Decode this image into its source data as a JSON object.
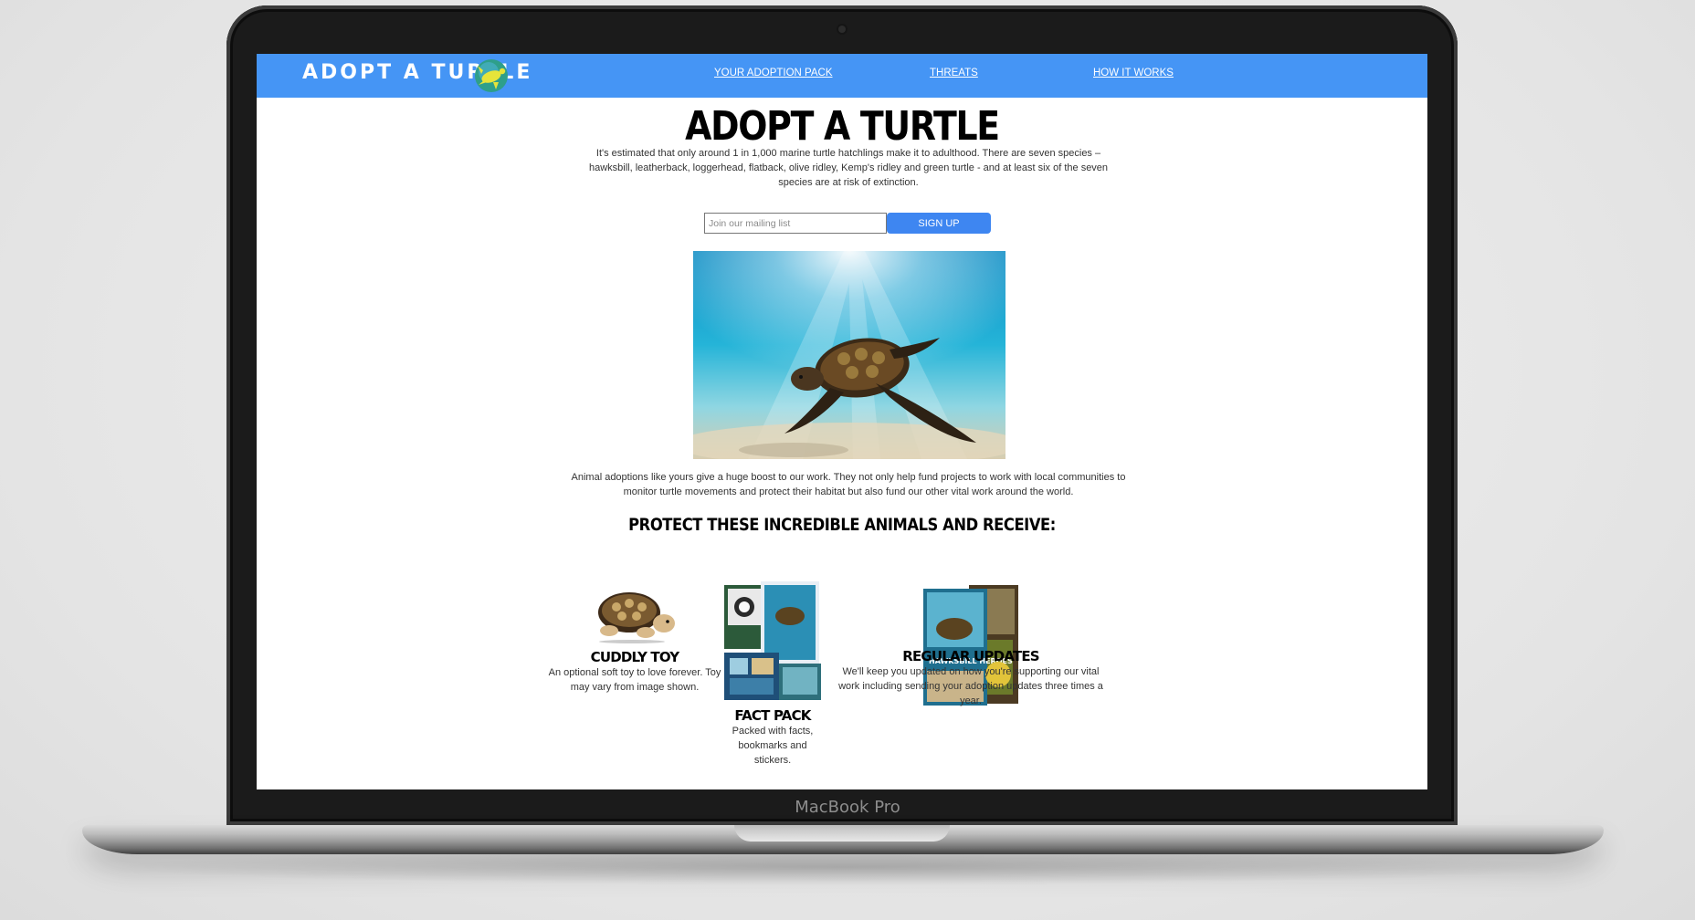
{
  "device": {
    "label": "MacBook Pro"
  },
  "site": {
    "logo_text": "ADOPT A TURTLE",
    "logo_icon": "turtle-logo-icon",
    "nav": [
      {
        "label": "YOUR ADOPTION PACK"
      },
      {
        "label": "THREATS"
      },
      {
        "label": "HOW IT WORKS"
      }
    ]
  },
  "hero": {
    "title": "ADOPT A TURTLE",
    "intro": "It's estimated that only around 1 in 1,000 marine turtle hatchlings make it to adulthood. There are seven species – hawksbill, leatherback, loggerhead, flatback, olive ridley, Kemp's ridley and green turtle - and at least six of the seven species are at risk of extinction.",
    "mailing_placeholder": "Join our mailing list",
    "signup_label": "SIGN UP",
    "image": "sea-turtle-underwater-photo"
  },
  "body_copy": "Animal adoptions like yours give a huge boost to our work. They not only help fund projects to work with local communities to monitor turtle movements and protect their habitat but also fund our other vital work around the world.",
  "section_heading": "PROTECT THESE INCREDIBLE ANIMALS AND RECEIVE:",
  "products": [
    {
      "title": "CUDDLY TOY",
      "description": "An optional soft toy to love forever. Toy may vary from image shown.",
      "image": "plush-turtle-toy"
    },
    {
      "title": "FACT PACK",
      "description": "Packed with facts, bookmarks and stickers.",
      "image": "fact-pack-booklets"
    },
    {
      "title": "REGULAR UPDATES",
      "description": "We'll keep you updated on how you're supporting our vital work including sending your adoption updates three times a year.",
      "image": "magazine-stack",
      "magazine_heading": "HAWKSBILL HEROES"
    }
  ],
  "colors": {
    "nav_bg": "#4595f5",
    "button_bg": "#3e86f1",
    "text": "#333333"
  }
}
